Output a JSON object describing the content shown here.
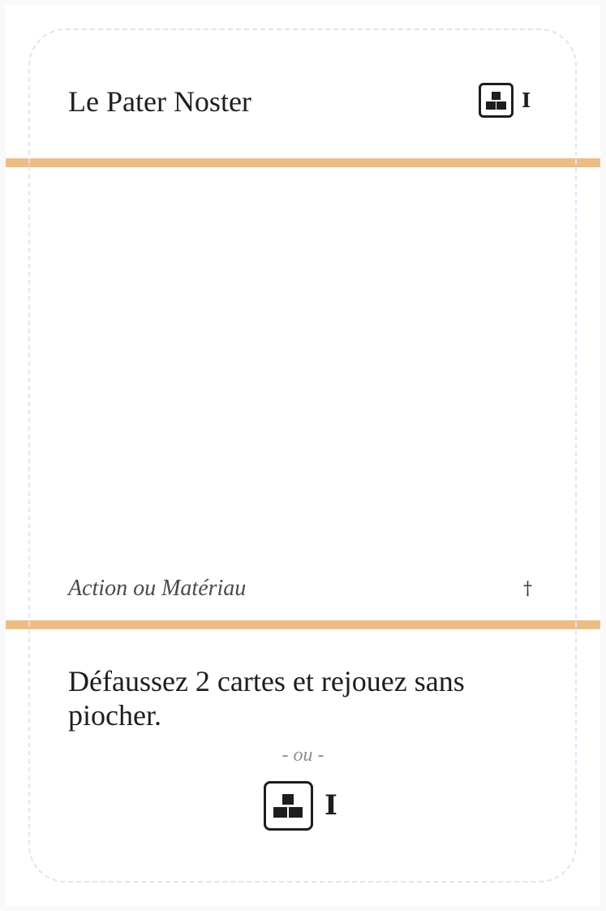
{
  "card": {
    "title": "Le Pater Noster",
    "cost": {
      "icon": "material-blocks-icon",
      "value": "I"
    },
    "type_line": "Action ou Matériau",
    "type_mark": "†",
    "effect_text": "Défaussez 2 cartes et rejouez sans piocher.",
    "alternative_separator": "- ou -",
    "alternative_cost": {
      "icon": "material-blocks-icon",
      "value": "I"
    }
  },
  "colors": {
    "band": "#ebbd87",
    "cut_line": "#e3e1f7",
    "text": "#1e1e1e"
  }
}
